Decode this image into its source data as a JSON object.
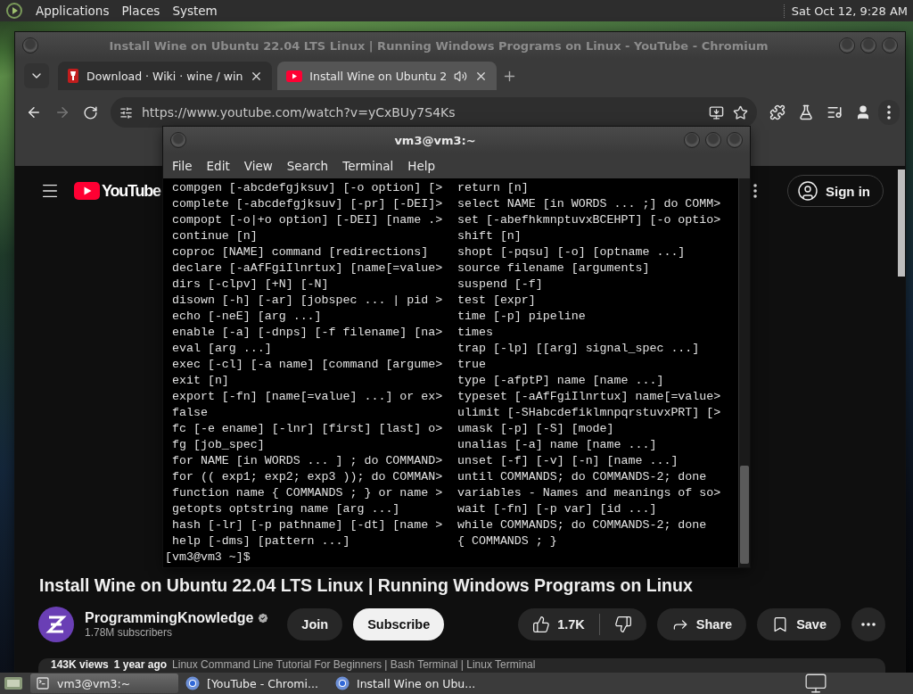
{
  "top_panel": {
    "menus": [
      "Applications",
      "Places",
      "System"
    ],
    "clock": "Sat Oct 12, 9:28 AM"
  },
  "browser": {
    "title": "Install Wine on Ubuntu 22.04 LTS Linux | Running Windows Programs on Linux - YouTube - Chromium",
    "tabs": [
      {
        "label": "Download · Wiki · wine / win",
        "selected": false,
        "kind": "wiki",
        "audio": false
      },
      {
        "label": "Install Wine on Ubuntu 2",
        "selected": true,
        "kind": "video",
        "audio": true
      }
    ],
    "forward_disabled": true,
    "url": "https://www.youtube.com/watch?v=yCxBUy7S4Ks",
    "page": {
      "logo": "YouTube",
      "sign_in": "Sign in",
      "title": "Install Wine on Ubuntu 22.04 LTS Linux | Running Windows Programs on Linux",
      "channel": "ProgrammingKnowledge",
      "subscribers": "1.78M subscribers",
      "join": "Join",
      "subscribe": "Subscribe",
      "likes": "1.7K",
      "share": "Share",
      "save": "Save",
      "views": "143K views",
      "age": "1 year ago",
      "description": "Linux Command Line Tutorial For Beginners | Bash Terminal | Linux Terminal"
    }
  },
  "terminal": {
    "title": "vm3@vm3:~",
    "menu": [
      "File",
      "Edit",
      "View",
      "Search",
      "Terminal",
      "Help"
    ],
    "lines_left": [
      "compgen [-abcdefgjksuv] [-o option] [>",
      "complete [-abcdefgjksuv] [-pr] [-DEI]>",
      "compopt [-o|+o option] [-DEI] [name .>",
      "continue [n]",
      "coproc [NAME] command [redirections]",
      "declare [-aAfFgiIlnrtux] [name[=value>",
      "dirs [-clpv] [+N] [-N]",
      "disown [-h] [-ar] [jobspec ... | pid >",
      "echo [-neE] [arg ...]",
      "enable [-a] [-dnps] [-f filename] [na>",
      "eval [arg ...]",
      "exec [-cl] [-a name] [command [argume>",
      "exit [n]",
      "export [-fn] [name[=value] ...] or ex>",
      "false",
      "fc [-e ename] [-lnr] [first] [last] o>",
      "fg [job_spec]",
      "for NAME [in WORDS ... ] ; do COMMAND>",
      "for (( exp1; exp2; exp3 )); do COMMAN>",
      "function name { COMMANDS ; } or name >",
      "getopts optstring name [arg ...]",
      "hash [-lr] [-p pathname] [-dt] [name >",
      "help [-dms] [pattern ...]"
    ],
    "lines_right": [
      "return [n]",
      "select NAME [in WORDS ... ;] do COMM>",
      "set [-abefhkmnptuvxBCEHPT] [-o optio>",
      "shift [n]",
      "shopt [-pqsu] [-o] [optname ...]",
      "source filename [arguments]",
      "suspend [-f]",
      "test [expr]",
      "time [-p] pipeline",
      "times",
      "trap [-lp] [[arg] signal_spec ...]",
      "true",
      "type [-afptP] name [name ...]",
      "typeset [-aAfFgiIlnrtux] name[=value>",
      "ulimit [-SHabcdefiklmnpqrstuvxPRT] [>",
      "umask [-p] [-S] [mode]",
      "unalias [-a] name [name ...]",
      "unset [-f] [-v] [-n] [name ...]",
      "until COMMANDS; do COMMANDS-2; done",
      "variables - Names and meanings of so>",
      "wait [-fn] [-p var] [id ...]",
      "while COMMANDS; do COMMANDS-2; done",
      "{ COMMANDS ; }"
    ],
    "prompt": "[vm3@vm3 ~]$"
  },
  "taskbar": {
    "items": [
      {
        "label": "vm3@vm3:~",
        "selected": true,
        "kind": "terminal"
      },
      {
        "label": "[YouTube - Chromi...",
        "selected": false,
        "kind": "browser"
      },
      {
        "label": "Install Wine on Ubu...",
        "selected": false,
        "kind": "browser"
      }
    ]
  }
}
